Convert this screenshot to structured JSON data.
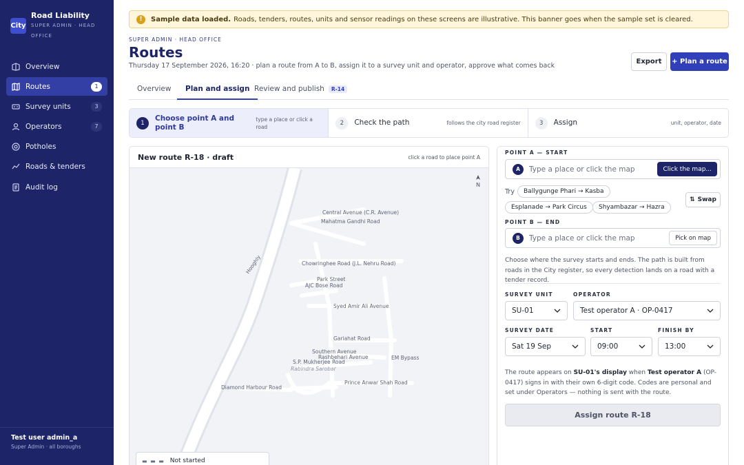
{
  "app": {
    "logo_text": "City",
    "title": "Road Liability",
    "subtitle": "SUPER ADMIN · HEAD OFFICE"
  },
  "sidebar": {
    "items": [
      {
        "label": "Overview",
        "icon": "grid-icon",
        "badge": ""
      },
      {
        "label": "Routes",
        "icon": "route-icon",
        "badge": "1"
      },
      {
        "label": "Survey units",
        "icon": "vehicle-icon",
        "badge": "3"
      },
      {
        "label": "Operators",
        "icon": "user-icon",
        "badge": "7"
      },
      {
        "label": "Potholes",
        "icon": "target-icon",
        "badge": ""
      },
      {
        "label": "Roads & tenders",
        "icon": "trend-icon",
        "badge": ""
      },
      {
        "label": "Audit log",
        "icon": "doc-icon",
        "badge": ""
      }
    ],
    "active_index": 1
  },
  "user": {
    "name": "Test user admin_a",
    "role": "Super Admin · all boroughs"
  },
  "banner": {
    "strong": "Sample data loaded.",
    "text": "Roads, tenders, routes, units and sensor readings on these screens are illustrative. This banner goes when the sample set is cleared."
  },
  "header": {
    "breadcrumb": "SUPER ADMIN · HEAD OFFICE",
    "title": "Routes",
    "subtitle": "Thursday 17 September 2026, 16:20 · plan a route from A to B, assign it to a survey unit and operator, approve what comes back",
    "export_label": "Export",
    "plan_label": "+ Plan a route"
  },
  "tabs": [
    {
      "label": "Overview",
      "badge": ""
    },
    {
      "label": "Plan and assign",
      "badge": ""
    },
    {
      "label": "Review and publish",
      "badge": "R-14"
    }
  ],
  "active_tab": 1,
  "steps": [
    {
      "num": "1",
      "title": "Choose point A and point B",
      "hint": "type a place or click a road"
    },
    {
      "num": "2",
      "title": "Check the path",
      "hint": "follows the city road register"
    },
    {
      "num": "3",
      "title": "Assign",
      "hint": "unit, operator, date"
    }
  ],
  "map": {
    "title": "New route R-18 · draft",
    "hint": "click a road to place point A",
    "compass": "N",
    "status": "Not started",
    "labels": [
      "Central Avenue (C.R. Avenue)",
      "Mahatma Gandhi Road",
      "Hooghly",
      "Chowringhee Road (J.L. Nehru Road)",
      "Park Street",
      "AJC Bose Road",
      "Syed Amir Ali Avenue",
      "Gariahat Road",
      "Southern Avenue",
      "Rashbehari Avenue",
      "S.P. Mukherjee Road",
      "Rabindra Sarobar",
      "EM Bypass",
      "Prince Anwar Shah Road",
      "Diamond Harbour Road"
    ]
  },
  "form": {
    "point_a_label": "POINT A — START",
    "point_a_badge": "A",
    "point_a_placeholder": "Type a place or click the map",
    "point_a_button": "Click the map...",
    "try_label": "Try",
    "suggestions": [
      "Ballygunge Phari → Kasba",
      "Esplanade → Park Circus",
      "Shyambazar → Hazra"
    ],
    "swap_label": "Swap",
    "point_b_label": "POINT B — END",
    "point_b_badge": "B",
    "point_b_placeholder": "Type a place or click the map",
    "point_b_button": "Pick on map",
    "description": "Choose where the survey starts and ends. The path is built from roads in the City register, so every detection lands on a road with a tender record.",
    "survey_unit_label": "SURVEY UNIT",
    "survey_unit_value": "SU-01",
    "operator_label": "OPERATOR",
    "operator_value": "Test operator A · OP-0417",
    "survey_date_label": "SURVEY DATE",
    "survey_date_value": "Sat 19 Sep",
    "start_label": "START",
    "start_value": "09:00",
    "finish_label": "FINISH BY",
    "finish_value": "13:00",
    "note_parts": {
      "p1": "The route appears on ",
      "b1": "SU-01's display",
      "p2": " when ",
      "b2": "Test operator A",
      "p3": " (OP-0417) signs in with their own 6-digit code. Codes are personal and set under Operators — nothing is sent with the route."
    },
    "assign_label": "Assign route R-18"
  }
}
